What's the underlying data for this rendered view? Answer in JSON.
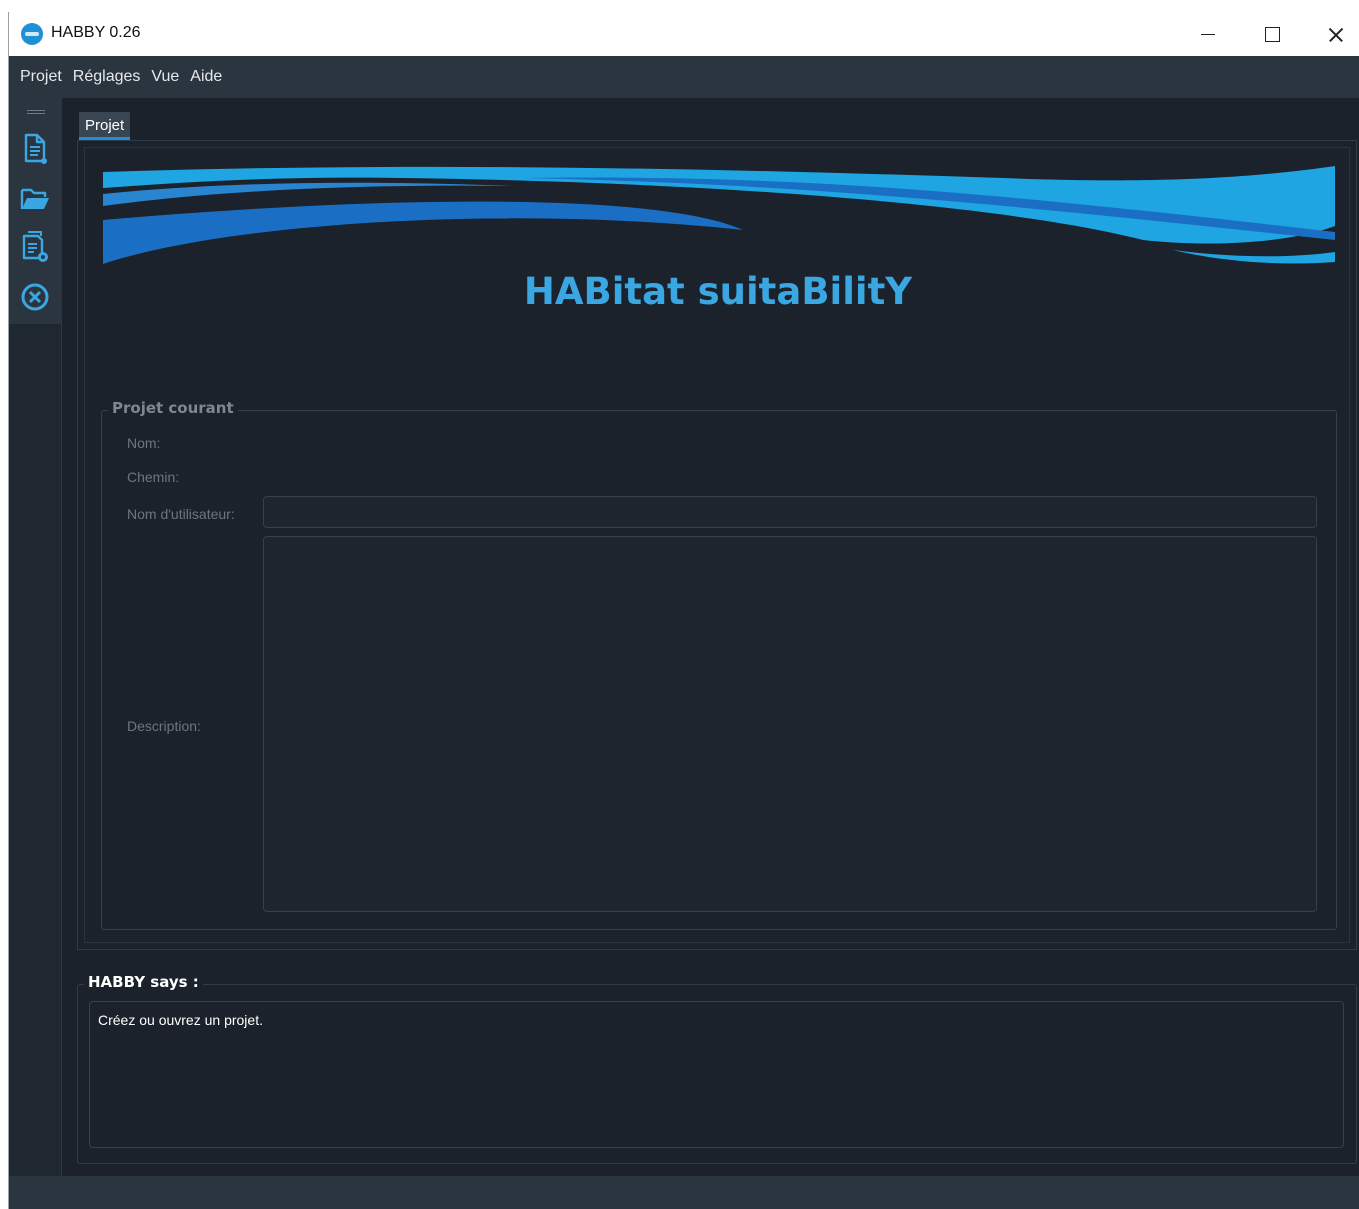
{
  "window": {
    "title": "HABBY 0.26",
    "icon": "habby-logo-icon",
    "controls": [
      "minimize-icon",
      "maximize-icon",
      "close-icon"
    ]
  },
  "menu": {
    "items": [
      "Projet",
      "Réglages",
      "Vue",
      "Aide"
    ]
  },
  "toolbar": {
    "buttons": [
      "new-project-icon",
      "open-folder-icon",
      "save-project-icon",
      "close-project-icon"
    ]
  },
  "tabs": [
    {
      "label": "Projet",
      "active": true
    }
  ],
  "banner": {
    "title": "HABitat suitaBilitY",
    "colors": {
      "light_blue": "#1fa6e2",
      "dark_blue": "#1a6fc4",
      "text": "#3aa7e3"
    }
  },
  "project_group": {
    "title": "Projet courant",
    "labels": {
      "name": "Nom:",
      "path": "Chemin:",
      "user": "Nom d'utilisateur:",
      "description": "Description:"
    },
    "values": {
      "name": "",
      "path": "",
      "user": "",
      "description": ""
    }
  },
  "habby_says": {
    "title": "HABBY says :",
    "message": "Créez ou ouvrez un projet."
  },
  "colors": {
    "background": "#1b222c",
    "menubar": "#2b3540",
    "accent": "#1f8fd6"
  }
}
